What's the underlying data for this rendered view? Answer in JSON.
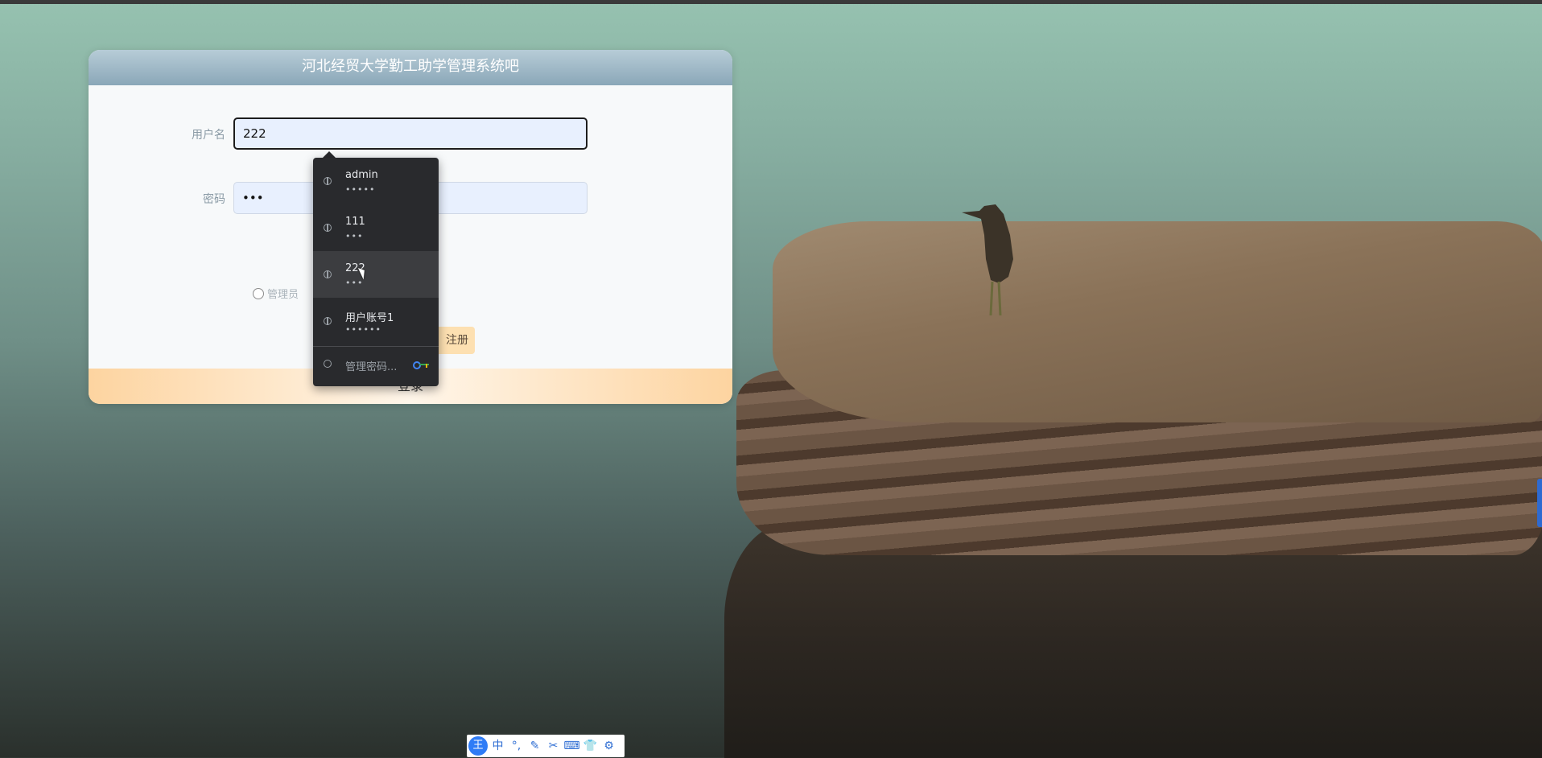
{
  "page": {
    "title": "河北经贸大学勤工助学管理系统吧"
  },
  "form": {
    "username_label": "用户名",
    "username_value": "222",
    "password_label": "密码",
    "password_value": "•••",
    "role_option": "管理员",
    "register_label": "注册",
    "login_label": "登录"
  },
  "autofill": {
    "items": [
      {
        "name": "admin",
        "password": "•••••"
      },
      {
        "name": "111",
        "password": "•••"
      },
      {
        "name": "222",
        "password": "•••"
      },
      {
        "name": "用户账号1",
        "password": "••••••"
      }
    ],
    "manage_label": "管理密码..."
  },
  "ime_toolbar": {
    "logo": "王",
    "buttons": [
      "中",
      "°,",
      "✎",
      "✂",
      "⌨",
      "👕",
      "⚙"
    ]
  },
  "colors": {
    "accent": "#2f7cf6",
    "header": "#8aa7b8",
    "footer": "#fdd4a0"
  }
}
